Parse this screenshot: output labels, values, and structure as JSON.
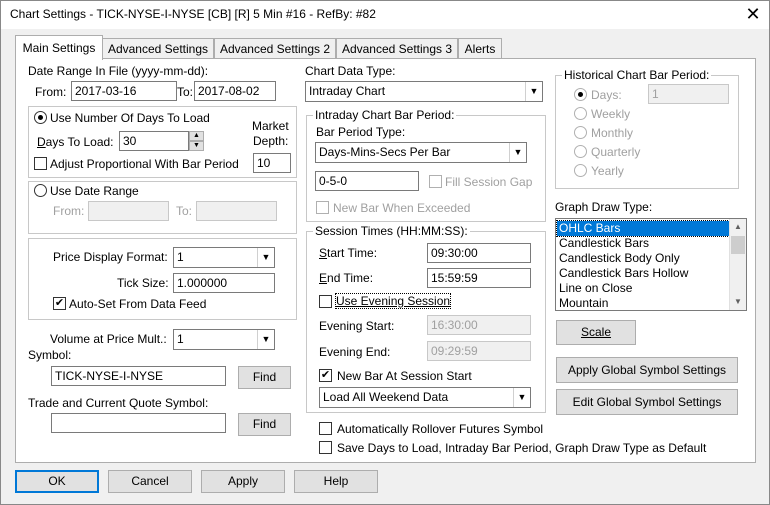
{
  "window": {
    "title": "Chart Settings - TICK-NYSE-I-NYSE [CB] [R]  5 Min  #16 - RefBy: #82",
    "close": "✕"
  },
  "tabs": [
    "Main Settings",
    "Advanced Settings",
    "Advanced Settings 2",
    "Advanced Settings 3",
    "Alerts"
  ],
  "date_range": {
    "label": "Date Range In File (yyyy-mm-dd):",
    "from_label": "From:",
    "from_value": "2017-03-16",
    "to_label": "To:",
    "to_value": "2017-08-02"
  },
  "days_group": {
    "use_days_label": "Use Number Of Days To Load",
    "days_label": "Days To Load:",
    "days_value": "30",
    "market_depth_label_1": "Market",
    "market_depth_label_2": "Depth:",
    "market_depth_value": "10",
    "adjust_label": "Adjust Proportional With Bar Period"
  },
  "date_range_group": {
    "label": "Use Date Range",
    "from_label": "From:",
    "to_label": "To:"
  },
  "price_group": {
    "format_label": "Price Display Format:",
    "format_value": "1",
    "tick_label": "Tick Size:",
    "tick_value": "1.000000",
    "autoset_label": "Auto-Set From Data Feed",
    "autoset_check": "✔"
  },
  "volume": {
    "label": "Volume at Price Mult.:",
    "value": "1"
  },
  "symbol": {
    "label": "Symbol:",
    "value": "TICK-NYSE-I-NYSE",
    "find": "Find"
  },
  "trade_symbol": {
    "label": "Trade and Current Quote Symbol:",
    "value": "",
    "find": "Find"
  },
  "chart_data_type": {
    "label": "Chart Data Type:",
    "value": "Intraday Chart"
  },
  "intraday_period": {
    "group_label": "Intraday Chart Bar Period:",
    "type_label": "Bar Period Type:",
    "type_value": "Days-Mins-Secs Per Bar",
    "period_value": "0-5-0",
    "fill_gap": "Fill Session Gap",
    "new_bar_exceeded": "New Bar When Exceeded"
  },
  "session": {
    "group_label": "Session Times (HH:MM:SS):",
    "start_label": "Start Time:",
    "start_value": "09:30:00",
    "end_label": "End Time:",
    "end_value": "15:59:59",
    "use_evening": "Use Evening Session",
    "evening_start_label": "Evening Start:",
    "evening_start_value": "16:30:00",
    "evening_end_label": "Evening End:",
    "evening_end_value": "09:29:59",
    "new_bar_label": "New Bar At Session Start",
    "new_bar_check": "✔",
    "weekend_value": "Load All Weekend Data"
  },
  "historical": {
    "group_label": "Historical Chart Bar Period:",
    "options": [
      "Days:",
      "Weekly",
      "Monthly",
      "Quarterly",
      "Yearly"
    ],
    "days_value": "1"
  },
  "graph_draw": {
    "label": "Graph Draw Type:",
    "items": [
      "OHLC Bars",
      "Candlestick Bars",
      "Candlestick Body Only",
      "Candlestick Bars Hollow",
      "Line on Close",
      "Mountain"
    ]
  },
  "buttons": {
    "scale": "Scale",
    "apply_global": "Apply Global Symbol Settings",
    "edit_global": "Edit Global Symbol Settings",
    "ok": "OK",
    "cancel": "Cancel",
    "apply": "Apply",
    "help": "Help"
  },
  "bottom_checks": {
    "rollover": "Automatically Rollover Futures Symbol",
    "save_default": "Save Days to Load, Intraday Bar Period, Graph Draw Type as Default"
  }
}
